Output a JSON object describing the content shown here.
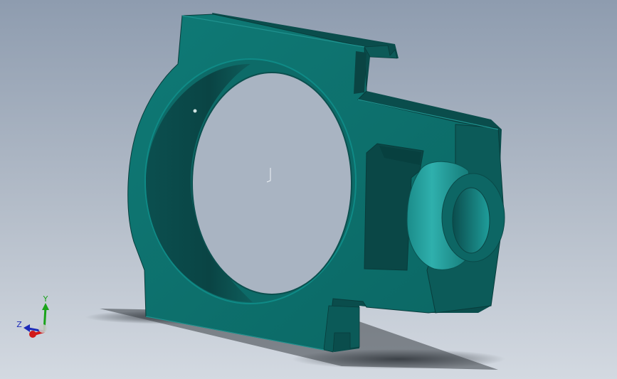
{
  "viewport": {
    "background_top": "#8f9db0",
    "background_bottom": "#cfd6df",
    "part_color": "#0b6e6b",
    "part_dark": "#0a4a4a",
    "part_highlight": "#2aa0a0",
    "shadow_color": "#3a3f46"
  },
  "triad": {
    "y_label": "Y",
    "z_label": "Z",
    "y_color": "#1aa31a",
    "z_color": "#1c2ab8",
    "x_color": "#d11a1a"
  }
}
